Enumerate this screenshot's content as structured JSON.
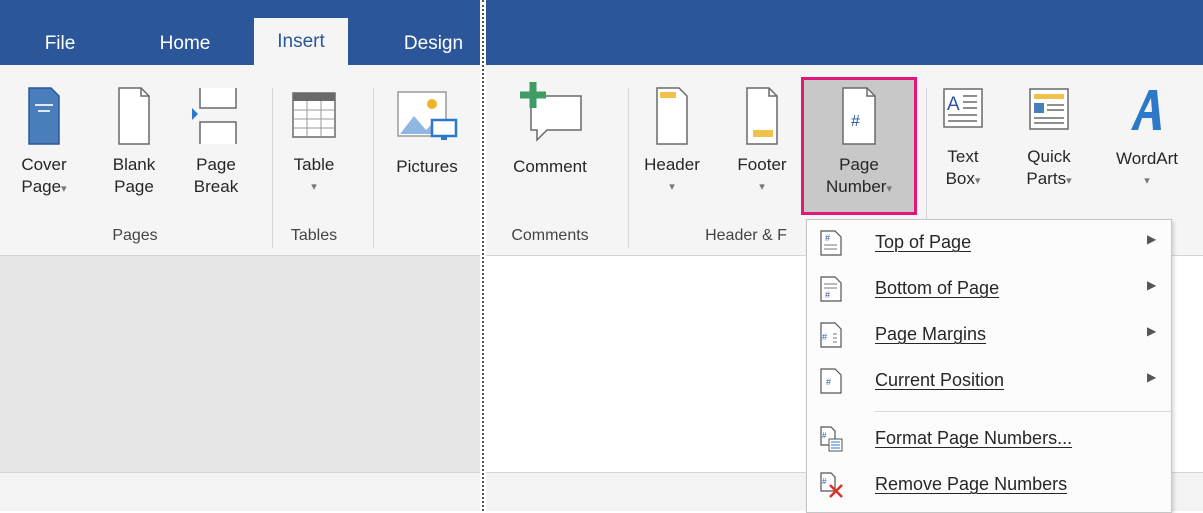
{
  "colors": {
    "accent": "#2b579a",
    "highlight": "#e3177a"
  },
  "tabs": {
    "file": "File",
    "home": "Home",
    "insert": "Insert",
    "design": "Design"
  },
  "ribbon": {
    "cover_page": {
      "line1": "Cover",
      "line2": "Page"
    },
    "blank_page": {
      "line1": "Blank",
      "line2": "Page"
    },
    "page_break": {
      "line1": "Page",
      "line2": "Break"
    },
    "table": {
      "line1": "Table"
    },
    "pictures": {
      "line1": "Pictures"
    },
    "comment": {
      "line1": "Comment"
    },
    "header": {
      "line1": "Header"
    },
    "footer": {
      "line1": "Footer"
    },
    "page_number": {
      "line1": "Page",
      "line2": "Number"
    },
    "text_box": {
      "line1": "Text",
      "line2": "Box"
    },
    "quick_parts": {
      "line1": "Quick",
      "line2": "Parts"
    },
    "wordart": {
      "line1": "WordArt"
    },
    "caret": "▾"
  },
  "groups": {
    "pages": "Pages",
    "tables": "Tables",
    "comments": "Comments",
    "header_footer": "Header & F"
  },
  "menu": [
    {
      "label": "Top of Page",
      "icon": "top-of-page-icon",
      "submenu": true
    },
    {
      "label": "Bottom of Page",
      "icon": "bottom-of-page-icon",
      "submenu": true
    },
    {
      "label": "Page Margins",
      "icon": "page-margins-icon",
      "submenu": true
    },
    {
      "label": "Current Position",
      "icon": "current-position-icon",
      "submenu": true
    },
    {
      "label": "Format Page Numbers...",
      "icon": "format-page-numbers-icon",
      "submenu": false
    },
    {
      "label": "Remove Page Numbers",
      "icon": "remove-page-numbers-icon",
      "submenu": false
    }
  ],
  "menu_arrow": "▶"
}
